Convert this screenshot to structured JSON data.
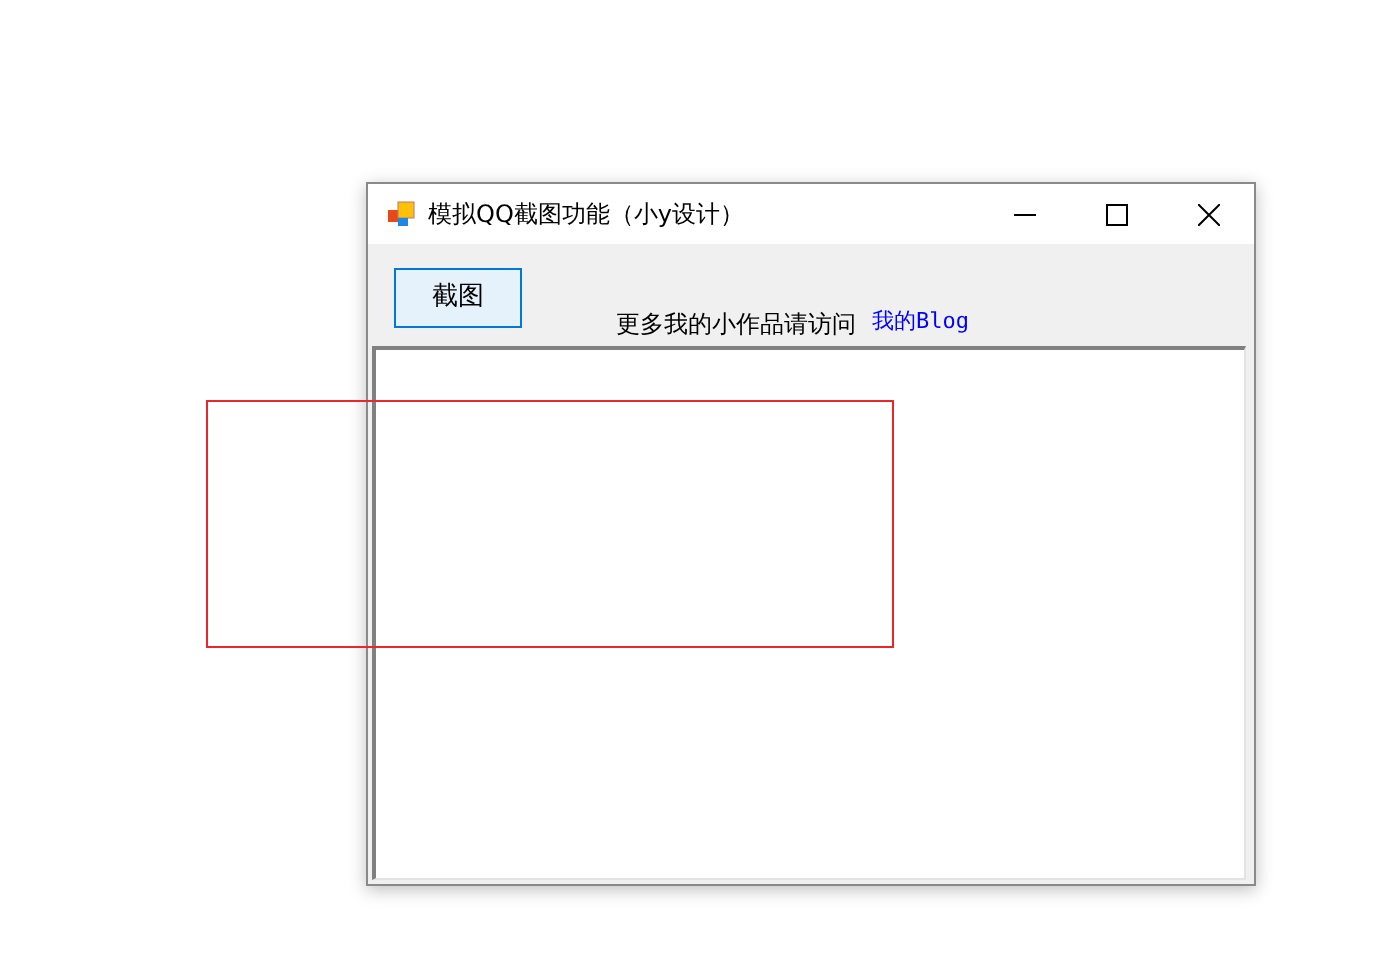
{
  "window": {
    "title": "模拟QQ截图功能（小y设计）"
  },
  "toolbar": {
    "button": "截图",
    "label": "更多我的小作品请访问",
    "link": "我的Blog"
  }
}
